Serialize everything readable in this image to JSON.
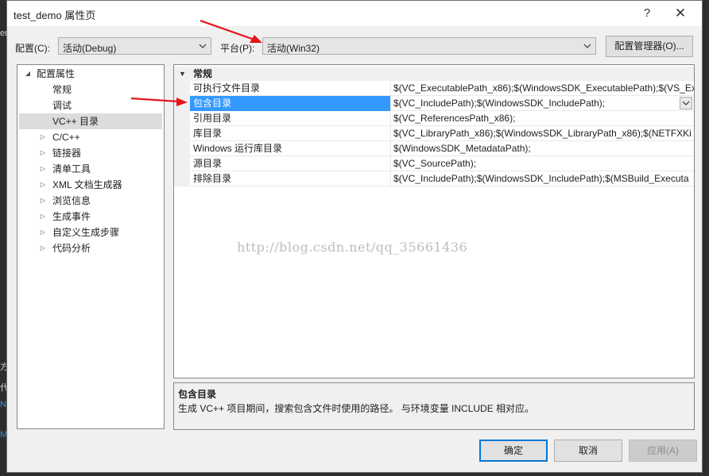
{
  "window": {
    "title": "test_demo 属性页",
    "help_glyph": "?",
    "close_glyph": "✕"
  },
  "config": {
    "label": "配置(C):",
    "value": "活动(Debug)",
    "platform_label": "平台(P):",
    "platform_value": "活动(Win32)",
    "manager_button": "配置管理器(O)..."
  },
  "tree": {
    "root": "配置属性",
    "items": [
      {
        "label": "常规"
      },
      {
        "label": "调试"
      },
      {
        "label": "VC++ 目录"
      },
      {
        "label": "C/C++"
      },
      {
        "label": "链接器"
      },
      {
        "label": "清单工具"
      },
      {
        "label": "XML 文档生成器"
      },
      {
        "label": "浏览信息"
      },
      {
        "label": "生成事件"
      },
      {
        "label": "自定义生成步骤"
      },
      {
        "label": "代码分析"
      }
    ]
  },
  "grid": {
    "category": "常规",
    "rows": [
      {
        "name": "可执行文件目录",
        "value": "$(VC_ExecutablePath_x86);$(WindowsSDK_ExecutablePath);$(VS_Ex"
      },
      {
        "name": "包含目录",
        "value": "$(VC_IncludePath);$(WindowsSDK_IncludePath);"
      },
      {
        "name": "引用目录",
        "value": "$(VC_ReferencesPath_x86);"
      },
      {
        "name": "库目录",
        "value": "$(VC_LibraryPath_x86);$(WindowsSDK_LibraryPath_x86);$(NETFXKi"
      },
      {
        "name": "Windows 运行库目录",
        "value": "$(WindowsSDK_MetadataPath);"
      },
      {
        "name": "源目录",
        "value": "$(VC_SourcePath);"
      },
      {
        "name": "排除目录",
        "value": "$(VC_IncludePath);$(WindowsSDK_IncludePath);$(MSBuild_Executa"
      }
    ]
  },
  "watermark": "http://blog.csdn.net/qq_35661436",
  "description": {
    "title": "包含目录",
    "text": "生成 VC++ 项目期间，搜索包含文件时使用的路径。 与环境变量 INCLUDE 相对应。"
  },
  "buttons": {
    "ok": "确定",
    "cancel": "取消",
    "apply": "应用(A)"
  },
  "background": {
    "edge_chars": [
      "er",
      "方",
      "代",
      "N",
      "M"
    ]
  },
  "colors": {
    "selection": "#3399ff",
    "annotation_arrow": "#e8141b",
    "primary_border": "#0078d7"
  }
}
